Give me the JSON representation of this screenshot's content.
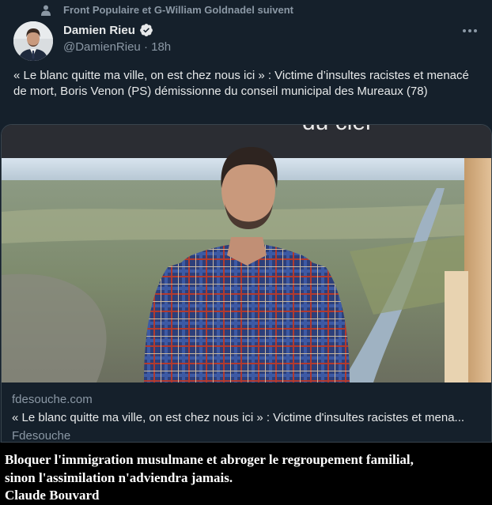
{
  "tweet": {
    "social_context": "Front Populaire et G-William Goldnadel suivent",
    "author_name": "Damien Rieu",
    "author_handle": "@DamienRieu",
    "separator": "·",
    "time": "18h",
    "text": "« Le blanc quitte ma ville, on est chez nous ici » : Victime d’insultes racistes et menacé de mort, Boris Venon (PS) démissionne du conseil municipal des Mureaux (78)",
    "card": {
      "domain": "fdesouche.com",
      "title": "« Le blanc quitte ma ville, on est chez nous ici » : Victime d'insultes racistes et mena...",
      "source": "Fdesouche",
      "image_sign_text": "du ciel"
    }
  },
  "caption": {
    "line1": "Bloquer l'immigration musulmane et abroger le regroupement familial,",
    "line2": "sinon l'assimilation n'adviendra jamais.",
    "line3": "Claude Bouvard"
  },
  "colors": {
    "background": "#15202b",
    "text": "#e7e9ea",
    "secondary": "#8b98a5",
    "border": "#38444d",
    "verified": "#e7e9ea",
    "caption_bg": "#000000"
  },
  "icons": [
    "person-icon",
    "verified-icon",
    "more-icon"
  ]
}
